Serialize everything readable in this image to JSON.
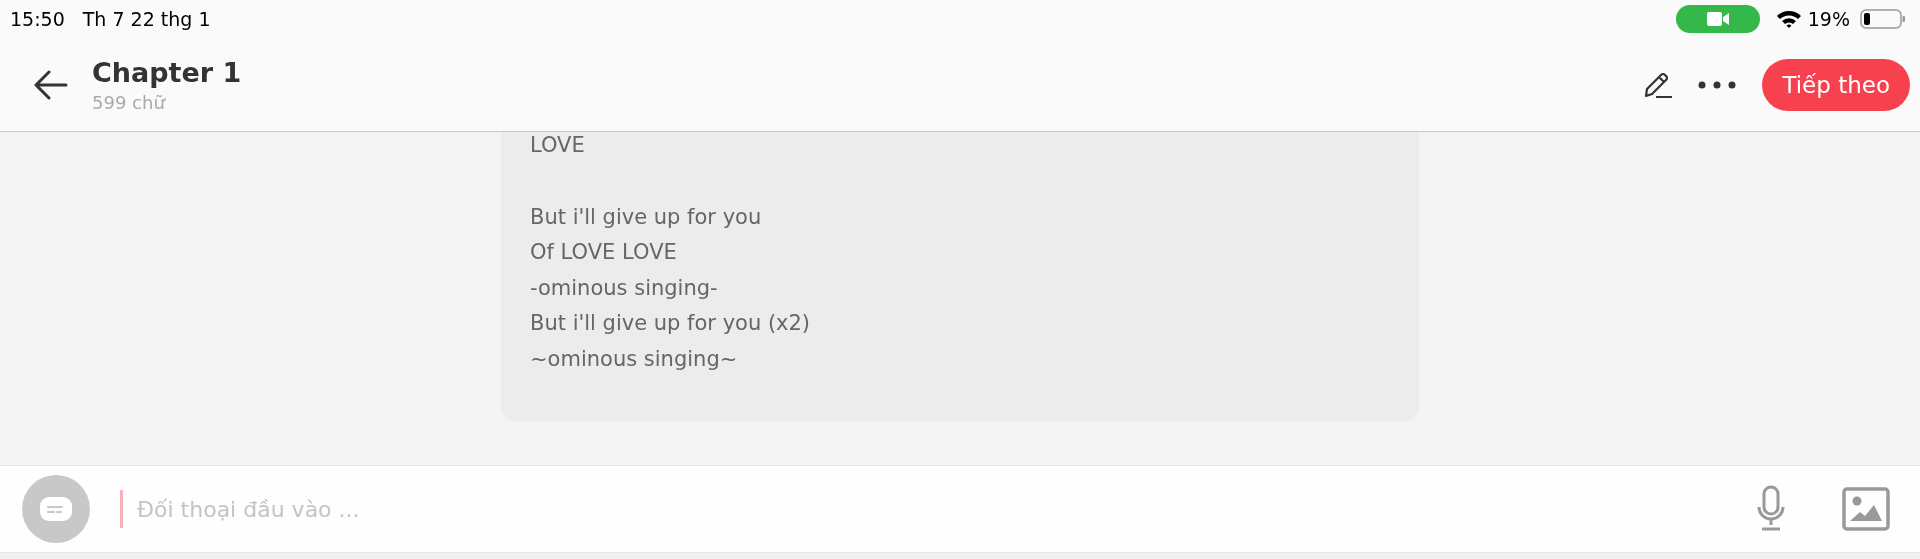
{
  "status_bar": {
    "time": "15:50",
    "date": "Th 7 22 thg 1",
    "battery": "19%"
  },
  "header": {
    "title": "Chapter 1",
    "subtitle": "599 chữ",
    "next_button": "Tiếp theo"
  },
  "message": {
    "paragraphs": [
      {
        "lines": [
          "LOVE"
        ]
      },
      {
        "lines": [
          "But i'll give up for you",
          "Of LOVE LOVE",
          "-ominous singing-",
          "But i'll give up for you (x2)",
          "~ominous singing~"
        ]
      }
    ]
  },
  "composer": {
    "placeholder": "Đối thoại đầu vào ..."
  }
}
